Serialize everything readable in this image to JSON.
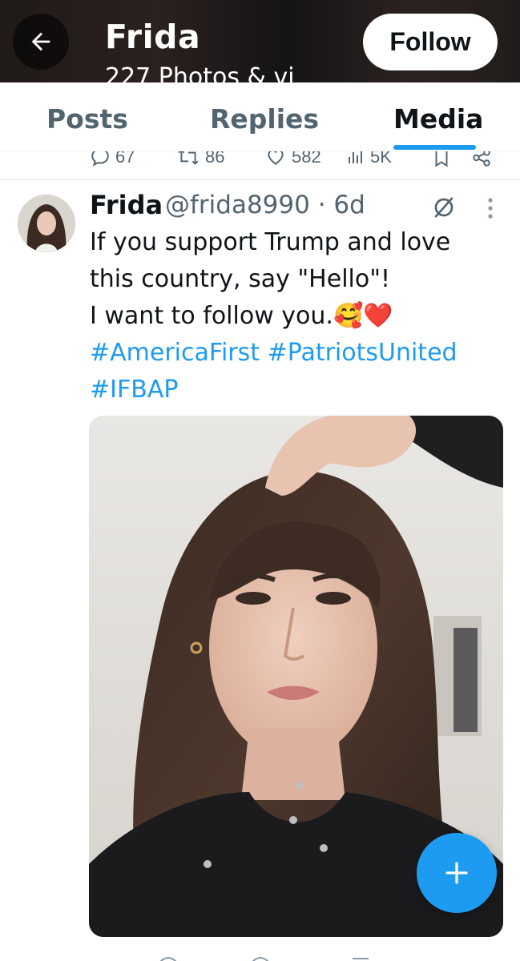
{
  "header": {
    "title": "Frida",
    "subtitle": "227 Photos & vi",
    "follow_label": "Follow"
  },
  "tabs": [
    {
      "label": "Posts",
      "active": false
    },
    {
      "label": "Replies",
      "active": false
    },
    {
      "label": "Media",
      "active": true
    }
  ],
  "previous_post": {
    "replies": "67",
    "reposts": "86",
    "likes": "582",
    "views": "5K"
  },
  "post": {
    "name": "Frida",
    "handle_time": "@frida8990 · 6d",
    "text_lines": [
      "If you support Trump and love",
      "this country, say \"Hello\"!",
      "I want to follow you.🥰❤️"
    ],
    "hashtags_line1": "#AmericaFirst #PatriotsUnited",
    "hashtags_line2": "#IFBAP"
  },
  "colors": {
    "accent": "#1d9bf0",
    "text_primary": "#0f1419",
    "text_secondary": "#536471"
  },
  "icons": {
    "back": "arrow-left-icon",
    "grok": "grok-icon",
    "more": "more-vertical-icon",
    "reply": "reply-icon",
    "repost": "repost-icon",
    "like": "heart-icon",
    "views": "views-icon",
    "bookmark": "bookmark-icon",
    "share": "share-icon",
    "compose": "plus-icon"
  }
}
